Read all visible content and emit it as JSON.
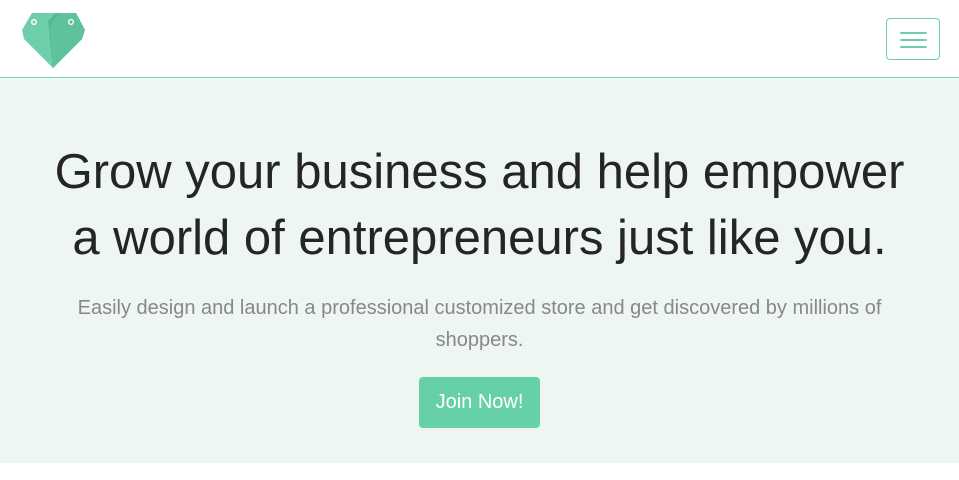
{
  "brand": {
    "logo_icon": "heart-tags-icon",
    "colors": {
      "primary": "#66d0a6",
      "primary_dark": "#56b892",
      "hero_background": "#eef6f1"
    }
  },
  "navbar": {
    "menu_icon": "hamburger-menu-icon"
  },
  "hero": {
    "title_line1": "Grow your business and help empower",
    "title_line2": "a world of entrepreneurs just like you.",
    "subtitle_line1": "Easily design and launch a professional customized store and get discovered by millions of",
    "subtitle_line2": "shoppers.",
    "cta_label": "Join Now!"
  }
}
